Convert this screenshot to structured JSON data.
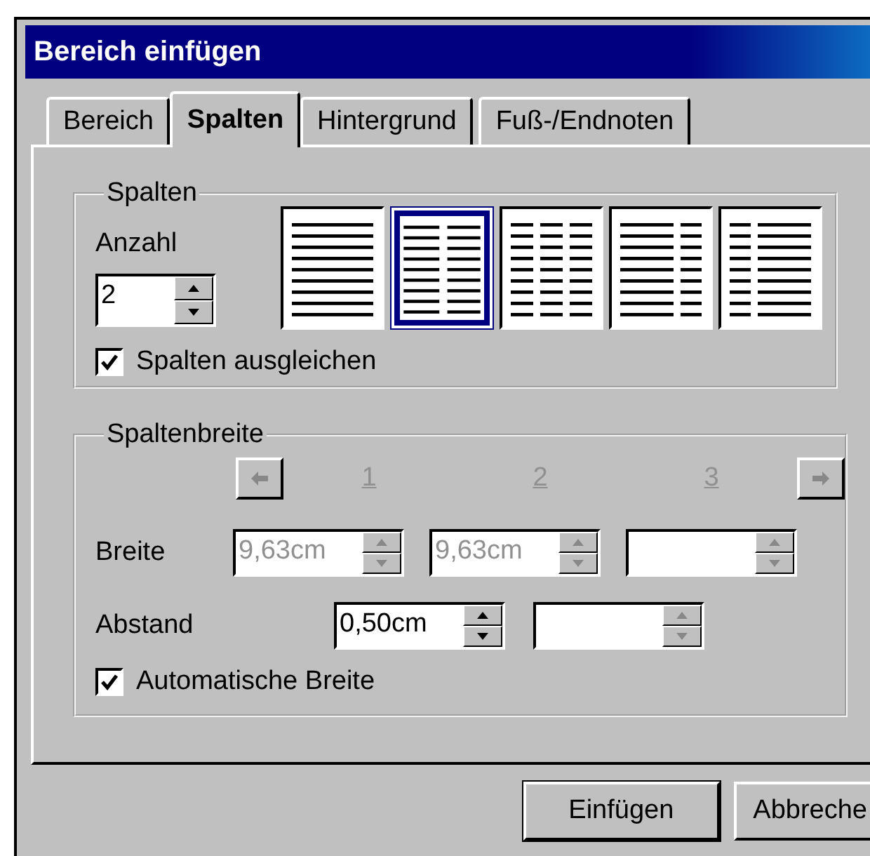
{
  "window": {
    "title": "Bereich einfügen"
  },
  "tabs": [
    {
      "label": "Bereich",
      "selected": false
    },
    {
      "label": "Spalten",
      "selected": true
    },
    {
      "label": "Hintergrund",
      "selected": false
    },
    {
      "label": "Fuß-/Endnoten",
      "selected": false
    }
  ],
  "columns_group": {
    "title": "Spalten",
    "count_label": "Anzahl",
    "count_value": "2",
    "presets": [
      {
        "kind": "one",
        "selected": false
      },
      {
        "kind": "two",
        "selected": true
      },
      {
        "kind": "three",
        "selected": false
      },
      {
        "kind": "wide-left",
        "selected": false
      },
      {
        "kind": "wide-right",
        "selected": false
      }
    ],
    "balance": {
      "label": "Spalten ausgleichen",
      "checked": true
    }
  },
  "width_group": {
    "title": "Spaltenbreite",
    "column_numbers": [
      "1",
      "2",
      "3"
    ],
    "width_label": "Breite",
    "widths": [
      {
        "value": "9,63cm",
        "disabled": true
      },
      {
        "value": "9,63cm",
        "disabled": true
      },
      {
        "disabled": true
      }
    ],
    "spacing_label": "Abstand",
    "spacings": [
      {
        "value": "0,50cm",
        "disabled": false
      },
      {
        "disabled": true
      }
    ],
    "auto_width": {
      "label": "Automatische Breite",
      "checked": true
    }
  },
  "buttons": [
    "Einfügen",
    "Abbreche"
  ]
}
